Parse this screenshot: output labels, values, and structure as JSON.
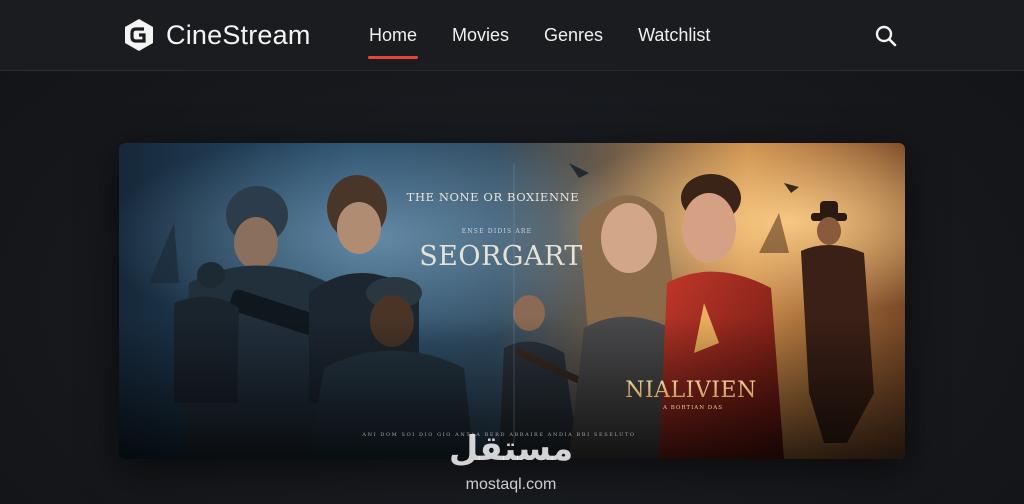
{
  "header": {
    "brand_name": "CineStream",
    "nav": [
      {
        "label": "Home",
        "active": true
      },
      {
        "label": "Movies",
        "active": false
      },
      {
        "label": "Genres",
        "active": false
      },
      {
        "label": "Watchlist",
        "active": false
      }
    ],
    "search_icon": "search-icon"
  },
  "hero": {
    "tagline": "THE NONE OR BOXIENNE",
    "subline": "ENSE DIDIS ARE",
    "left_title": "SEORGART",
    "right_title": "NIALIVIEN",
    "right_subline": "A BORTIAN DAS",
    "credits": "ANI DOM SOI DIO GIO ANTAA BERD ABRAIRE ANDIA BRI SESELUTO"
  },
  "watermark": {
    "arabic": "مستقل",
    "latin": "mostaql.com"
  },
  "colors": {
    "accent": "#e0483a",
    "header_bg": "#1b1c20",
    "page_bg": "#16181c"
  }
}
